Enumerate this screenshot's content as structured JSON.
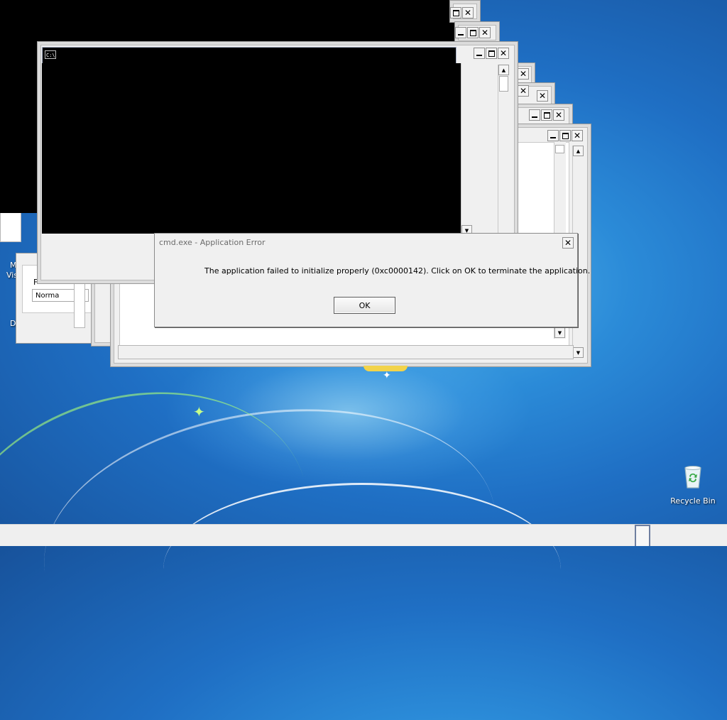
{
  "desktop": {
    "recycle_bin_label": "Recycle Bin",
    "left_fragments": [
      "M",
      "Vis",
      "D"
    ]
  },
  "background_dialog": {
    "label_fragment": "F",
    "field_value": "Norma"
  },
  "cmd_window": {
    "icon_text": "C:\\",
    "title": ""
  },
  "caption_buttons": {
    "minimize": "",
    "maximize": "",
    "close": "✕"
  },
  "error_dialog": {
    "title": "cmd.exe - Application Error",
    "message": "The application failed to initialize properly (0xc0000142). Click on OK to terminate the application.",
    "ok_label": "OK",
    "close_glyph": "✕"
  },
  "scroll_glyphs": {
    "up": "▲",
    "down": "▼"
  },
  "colors": {
    "desktop_blue": "#1f6fc4",
    "window_face": "#f0f0f0",
    "console_black": "#000000"
  }
}
